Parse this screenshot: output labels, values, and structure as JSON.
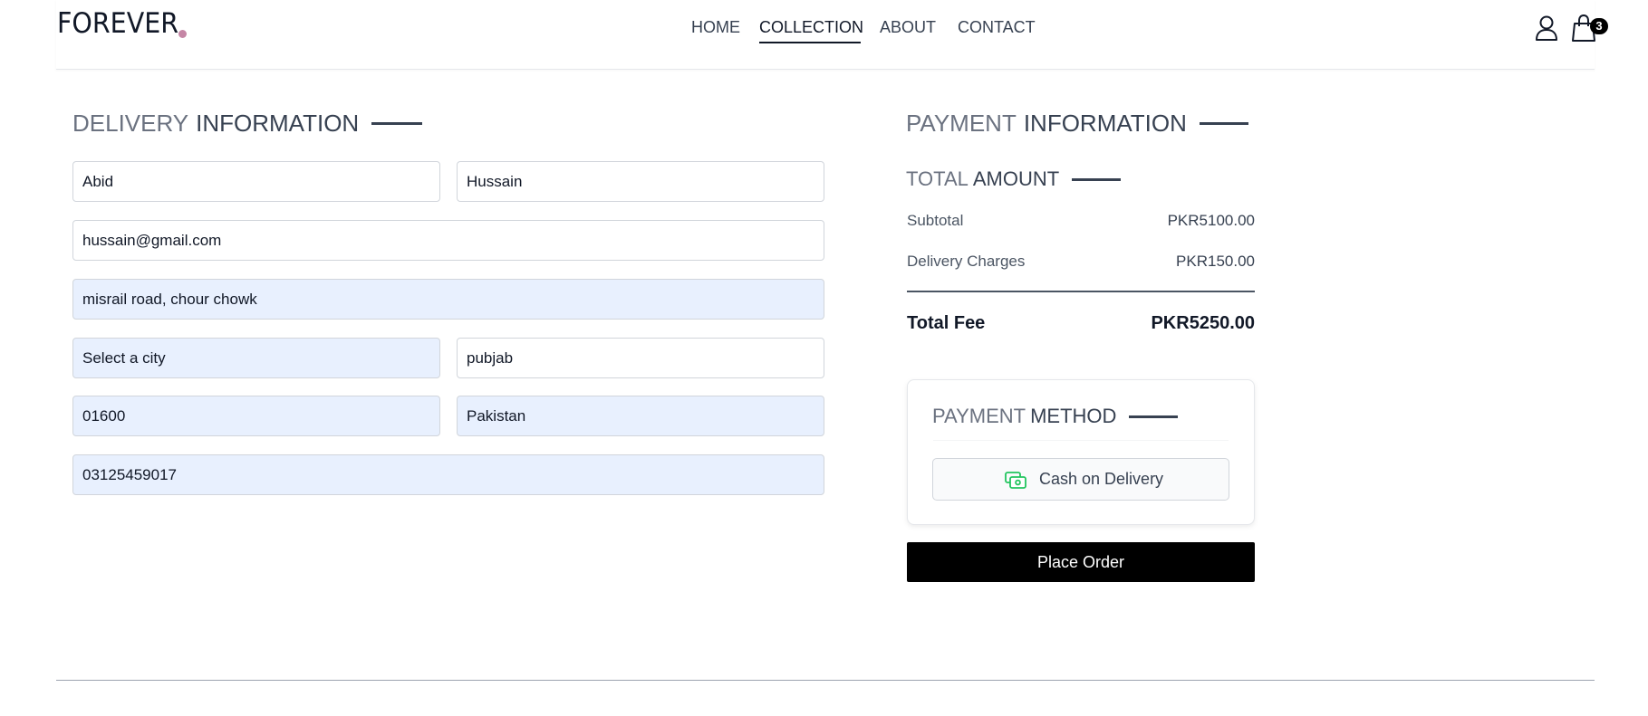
{
  "brand": {
    "logo_text": "FOREVER",
    "dot_color": "#c586a5"
  },
  "nav": {
    "items": [
      {
        "label": "HOME"
      },
      {
        "label": "COLLECTION"
      },
      {
        "label": "ABOUT"
      },
      {
        "label": "CONTACT"
      }
    ],
    "active": "COLLECTION"
  },
  "header_icons": {
    "user": "user-icon",
    "cart": "shopping-bag-icon",
    "cart_count": "3"
  },
  "delivery": {
    "title_light": "DELIVERY",
    "title_dark": "INFORMATION",
    "first_name": "Abid",
    "last_name": "Hussain",
    "email": "hussain@gmail.com",
    "street": "misrail road, chour chowk",
    "city": "Select a city",
    "state": "pubjab",
    "zipcode": "01600",
    "country": "Pakistan",
    "phone": "03125459017"
  },
  "payment": {
    "title_light": "PAYMENT",
    "title_dark": "INFORMATION",
    "total_title_light": "TOTAL",
    "total_title_dark": "AMOUNT",
    "subtotal_label": "Subtotal",
    "subtotal_value": "PKR5100.00",
    "delivery_label": "Delivery Charges",
    "delivery_value": "PKR150.00",
    "total_label": "Total Fee",
    "total_value": "PKR5250.00",
    "method_title_light": "PAYMENT",
    "method_title_dark": "METHOD",
    "method_option": "Cash on Delivery",
    "method_icon": "cash-icon",
    "method_icon_color": "#22c55e",
    "place_order_label": "Place Order"
  }
}
